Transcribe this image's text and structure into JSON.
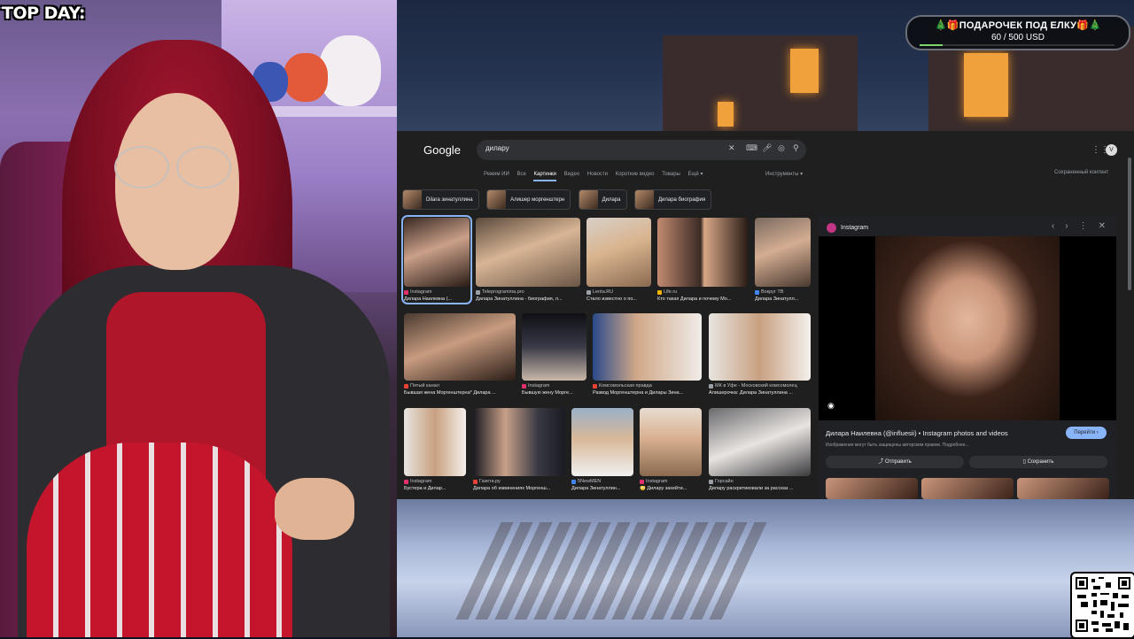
{
  "overlay": {
    "top_day": "TOP DAY:",
    "donation_title": "🎄🎁ПОДАРОЧЕК ПОД ЕЛКУ🎁🎄",
    "donation_amount": "60 / 500 USD",
    "donation_progress": 0.12
  },
  "browser": {
    "logo": "Google",
    "search_query": "дилару",
    "tabs": [
      "Режим ИИ",
      "Все",
      "Картинки",
      "Видео",
      "Новости",
      "Короткие видео",
      "Товары",
      "Ещё ▾"
    ],
    "active_tab": "Картинки",
    "tools": "Инструменты ▾",
    "saved": "Сохраненный контент",
    "chips": [
      "Dilara зинатуллина",
      "Алишер моргенштерн",
      "Дилара",
      "Дилара биография"
    ],
    "results": [
      {
        "source": "Instagram",
        "title": "Дилара Наилевна (..."
      },
      {
        "source": "Teleprogramma.pro",
        "title": "Дилара Зинатуллина - биография, л..."
      },
      {
        "source": "Lenta.RU",
        "title": "Стало известно о по..."
      },
      {
        "source": "Life.ru",
        "title": "Кто такая Дилара и почему Мо..."
      },
      {
        "source": "Вокруг ТВ",
        "title": "Дилара Зинатулл..."
      },
      {
        "source": "Пятый канал",
        "title": "Бывшая жена Моргенштерна* Дилара ..."
      },
      {
        "source": "Instagram",
        "title": "Бывшую жену Морге..."
      },
      {
        "source": "Комсомольская правда",
        "title": "Развод Моргенштерна и Дилары Зина..."
      },
      {
        "source": "МК в Уфе - Московский комсомолец",
        "title": "Алишерочка: Дилара Зинатуллина ..."
      },
      {
        "source": "Instagram",
        "title": "Бустера и Дилар..."
      },
      {
        "source": "Газета.ру",
        "title": "Дилара об извинениях Моргенш..."
      },
      {
        "source": "5NewMEN",
        "title": "Дилара Зинатуллин..."
      },
      {
        "source": "Instagram",
        "title": "😳 Дилару захейти..."
      },
      {
        "source": "Горсайн",
        "title": "Дилару раскритиковали за рассказ ..."
      }
    ],
    "panel": {
      "source": "Instagram",
      "title": "Дилара Наилевна (@influesii) • Instagram photos and videos",
      "notice": "Изображения могут быть защищены авторским правом. Подробнее...",
      "go_label": "Перейти ›",
      "share_label": "Отправить",
      "save_label": "Сохранить"
    }
  }
}
